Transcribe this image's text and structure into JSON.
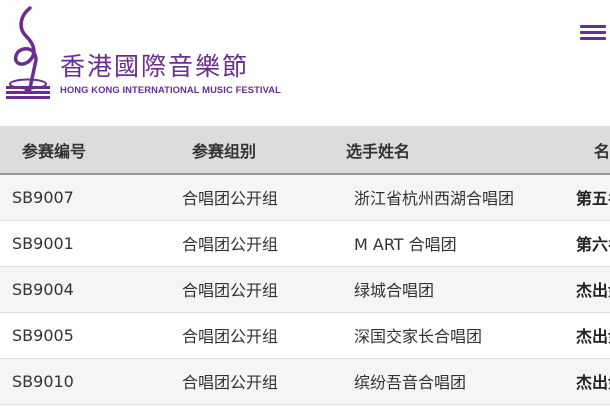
{
  "header": {
    "logo_cn": "香港國際音樂節",
    "logo_en": "HONG KONG INTERNATIONAL MUSIC FESTIVAL"
  },
  "colors": {
    "brand_purple": "#6b2d8f",
    "header_row_bg": "#dcdcdc",
    "row_alt_bg": "#f5f5f5"
  },
  "table": {
    "headers": [
      "参赛编号",
      "参赛组别",
      "选手姓名",
      "名次"
    ],
    "rows": [
      {
        "id": "SB9007",
        "group": "合唱团公开组",
        "name": "浙江省杭州西湖合唱团",
        "rank": "第五名"
      },
      {
        "id": "SB9001",
        "group": "合唱团公开组",
        "name": "M ART 合唱团",
        "rank": "第六名"
      },
      {
        "id": "SB9004",
        "group": "合唱团公开组",
        "name": "绿城合唱团",
        "rank": "杰出金奖"
      },
      {
        "id": "SB9005",
        "group": "合唱团公开组",
        "name": "深国交家长合唱团",
        "rank": "杰出金奖"
      },
      {
        "id": "SB9010",
        "group": "合唱团公开组",
        "name": "缤纷吾音合唱团",
        "rank": "杰出金奖"
      }
    ]
  }
}
